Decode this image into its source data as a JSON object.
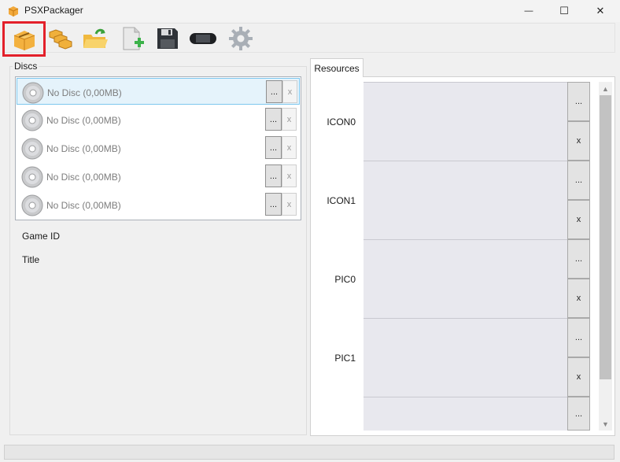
{
  "window": {
    "title": "PSXPackager",
    "controls": {
      "minimize": "—",
      "maximize": "☐",
      "close": "✕"
    }
  },
  "toolbar": {
    "buttons": [
      {
        "name": "open-package-icon",
        "active": true
      },
      {
        "name": "batch-icon",
        "active": false
      },
      {
        "name": "open-folder-icon",
        "active": false
      },
      {
        "name": "new-file-icon",
        "active": false
      },
      {
        "name": "save-icon",
        "active": false
      },
      {
        "name": "psp-device-icon",
        "active": false
      },
      {
        "name": "settings-gear-icon",
        "active": false
      }
    ]
  },
  "discs": {
    "title": "Discs",
    "items": [
      {
        "label": "No Disc (0,00MB)",
        "browse": "...",
        "remove": "x",
        "selected": true
      },
      {
        "label": "No Disc (0,00MB)",
        "browse": "...",
        "remove": "x",
        "selected": false
      },
      {
        "label": "No Disc (0,00MB)",
        "browse": "...",
        "remove": "x",
        "selected": false
      },
      {
        "label": "No Disc (0,00MB)",
        "browse": "...",
        "remove": "x",
        "selected": false
      },
      {
        "label": "No Disc (0,00MB)",
        "browse": "...",
        "remove": "x",
        "selected": false
      }
    ],
    "game_id_label": "Game ID",
    "title_label": "Title"
  },
  "resources": {
    "tab_label": "Resources",
    "items": [
      {
        "label": "ICON0",
        "browse": "...",
        "remove": "x"
      },
      {
        "label": "ICON1",
        "browse": "...",
        "remove": "x"
      },
      {
        "label": "PIC0",
        "browse": "...",
        "remove": "x"
      },
      {
        "label": "PIC1",
        "browse": "...",
        "remove": "x"
      },
      {
        "label": "",
        "browse": "...",
        "remove": ""
      }
    ]
  },
  "colors": {
    "active_outline": "#e3202a",
    "selected_row": "#e5f3fb"
  }
}
